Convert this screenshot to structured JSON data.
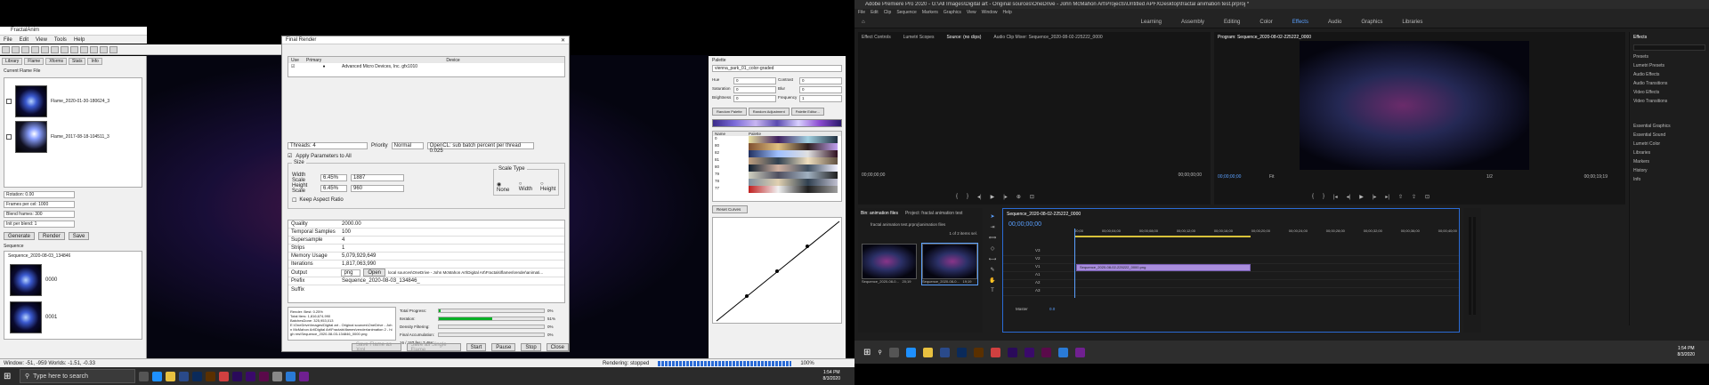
{
  "left": {
    "window_title": "FractalAnim",
    "menu": [
      "File",
      "Edit",
      "View",
      "Tools",
      "Help"
    ],
    "library": {
      "tabs": [
        "Library",
        "Flame",
        "Xforms",
        "Stats",
        "Info"
      ],
      "header": "Current Flame File",
      "items": [
        {
          "name": "Flame_2020-01-30-180624_3"
        },
        {
          "name": "Flame_2017-08-18-104511_3"
        }
      ],
      "fields": [
        {
          "label": "Rotation: 0.00",
          "value": "0"
        },
        {
          "label": "Frames per cel: 1000",
          "value": ""
        },
        {
          "label": "Blend frames: 300",
          "value": ""
        },
        {
          "label": "Init per blend: 1",
          "value": ""
        }
      ],
      "buttons": [
        "Generate",
        "Render",
        "Save"
      ],
      "sequence_label": "Sequence",
      "sequence_file": "Sequence_2020-08-03_134846",
      "frames": [
        "0000",
        "0001"
      ]
    },
    "dialog": {
      "title": "Final Render",
      "device_headers": [
        "Use",
        "Primary",
        "Device"
      ],
      "device_row": {
        "primary": "●",
        "device": "Advanced Micro Devices, Inc. gfx1010"
      },
      "threads_label": "Threads: 4",
      "priority_label": "Priority",
      "priority_value": "Normal",
      "opencl_label": "OpenCL: sub batch percent per thread 0.025",
      "apply_label": "Apply Parameters to All",
      "size_group": "Size",
      "width_label": "Width Scale",
      "width_pct": "6.45%",
      "width_px": "1887",
      "height_label": "Height Scale",
      "height_pct": "6.45%",
      "height_px": "960",
      "keep_aspect": "Keep Aspect Ratio",
      "scale_type_group": "Scale Type",
      "scale_types": [
        "None",
        "Width",
        "Height"
      ],
      "params": [
        {
          "label": "Quality",
          "value": "2000.00"
        },
        {
          "label": "Temporal Samples",
          "value": "100"
        },
        {
          "label": "Supersample",
          "value": "4"
        },
        {
          "label": "Strips",
          "value": "1"
        },
        {
          "label": "Memory Usage",
          "value": "5,079,929,649"
        },
        {
          "label": "Iterations",
          "value": "1,817,063,990"
        }
      ],
      "output_label": "Output",
      "output_format": "png",
      "open_label": "Open",
      "output_path": "local sources\\OneDrive - John McMahon Art\\Digital Art\\Fractals\\flames\\render\\animati...",
      "prefix_label": "Prefix",
      "prefix_value": "Sequence_2020-08-03_134846_",
      "suffix_label": "Suffix",
      "log_lines": [
        "Render: Best: 0.25%",
        "Total Iters: 1,816,674,990",
        "BatchesDone: 325,953,013"
      ],
      "log_path": "E:\\OneDrive\\Images\\Digital art - Original sources\\OneDrive - John McMahon Art\\Digital Art\\Fractals\\flames\\render\\animation 2 - high res\\Sequence_2020-08-03-134846_0000.png",
      "progress": [
        {
          "label": "Total Progress:",
          "pct": "0%",
          "value": 0.02
        },
        {
          "label": "Iteration:",
          "pct": "51%",
          "value": 0.51
        },
        {
          "label": "Density Filtering:",
          "pct": "0%",
          "value": 0
        },
        {
          "label": "Final Accumulation:",
          "pct": "0%",
          "value": 0
        }
      ],
      "fps_status": "16 / 157 fps: 7.45s",
      "bottom_buttons": [
        "Save Flame as Xml",
        "Save as Single Flame",
        "Start",
        "Pause",
        "Stop",
        "Close"
      ]
    },
    "palette": {
      "title": "Palette",
      "selected": "vienna_park_01_color-graded",
      "adjust": [
        {
          "label": "Hue",
          "value": "0"
        },
        {
          "label": "Contrast",
          "value": "0"
        },
        {
          "label": "Saturation",
          "value": "0"
        },
        {
          "label": "Blur",
          "value": "0"
        },
        {
          "label": "Brightness",
          "value": "0"
        },
        {
          "label": "Frequency",
          "value": "1"
        }
      ],
      "buttons": [
        "Random Palette",
        "Random Adjustment",
        "Palette Editor..."
      ],
      "list_headers": [
        "Name",
        "Palette"
      ],
      "rows": [
        "0",
        "80",
        "82",
        "81",
        "80",
        "79",
        "78",
        "77"
      ],
      "reset_curves": "Reset Curves"
    },
    "status": {
      "window": "Window: -51, -959 Worlds: -1.51, -0.33",
      "rendering": "Rendering: stopped",
      "percent": "100%"
    },
    "taskbar": {
      "search_placeholder": "Type here to search",
      "time": "1:54 PM",
      "date": "8/3/2020"
    }
  },
  "right": {
    "title": "Adobe Premiere Pro 2020 - G:\\All Images\\Digital art - Original sources\\OneDrive - John McMahon Art\\Projects\\Untitled APFXDesktop\\fractal animation test.prproj *",
    "menu": [
      "File",
      "Edit",
      "Clip",
      "Sequence",
      "Markers",
      "Graphics",
      "View",
      "Window",
      "Help"
    ],
    "workspaces": [
      "Learning",
      "Assembly",
      "Editing",
      "Color",
      "Effects",
      "Audio",
      "Graphics",
      "Libraries"
    ],
    "active_workspace": "Effects",
    "source_tabs": [
      "Effect Controls",
      "Lumetri Scopes",
      "Source: (no clips)",
      "Audio Clip Mixer: Sequence_2020-08-02-225222_0000"
    ],
    "source_time_left": "00;00;00;00",
    "source_time_right": "00;00;00;00",
    "program_tab": "Program: Sequence_2020-08-02-225222_0000",
    "program_time_left": "00;00;00;00",
    "program_fit": "Fit",
    "program_ratio": "1/2",
    "program_time_right": "00;00;19;19",
    "bin_tabs": [
      "Bin: animation files",
      "Project: fractal animation test"
    ],
    "bin_path": "fractal animation test.prproj\\animation files",
    "bin_count": "1 of 2 items sel.",
    "bin_items": [
      {
        "name": "Sequence_2020-08-0...",
        "dur": "20;19"
      },
      {
        "name": "Sequence_2020-08-0...",
        "dur": "19;19"
      }
    ],
    "timeline_tab": "Sequence_2020-08-02-225222_0000",
    "timeline_time": "00;00;00;00",
    "ruler": [
      "00;00",
      "00;00;04;00",
      "00;00;08;00",
      "00;00;12;00",
      "00;00;16;00",
      "00;00;20;00",
      "00;00;24;00",
      "00;00;28;00",
      "00;00;32;00",
      "00;00;36;00",
      "00;00;40;00"
    ],
    "tracks": [
      "V3",
      "V2",
      "V1",
      "A1",
      "A2",
      "A3"
    ],
    "clip_label": "Sequence_2020-08-02-225222_0000.png",
    "master_label": "Master",
    "master_value": "0.0",
    "effects_title": "Effects",
    "effects_items": [
      "Presets",
      "Lumetri Presets",
      "Audio Effects",
      "Audio Transitions",
      "Video Effects",
      "Video Transitions"
    ],
    "effects_panels": [
      "Essential Graphics",
      "Essential Sound",
      "Lumetri Color",
      "Libraries",
      "Markers",
      "History",
      "Info"
    ],
    "taskbar_time": "1:54 PM",
    "taskbar_date": "8/3/2020"
  },
  "colors": {
    "premiere_accent": "#2a6bd6",
    "clip_purple": "#a98ddd",
    "fractal_pink": "#d246d2",
    "fractal_blue": "#3b5ad0"
  }
}
